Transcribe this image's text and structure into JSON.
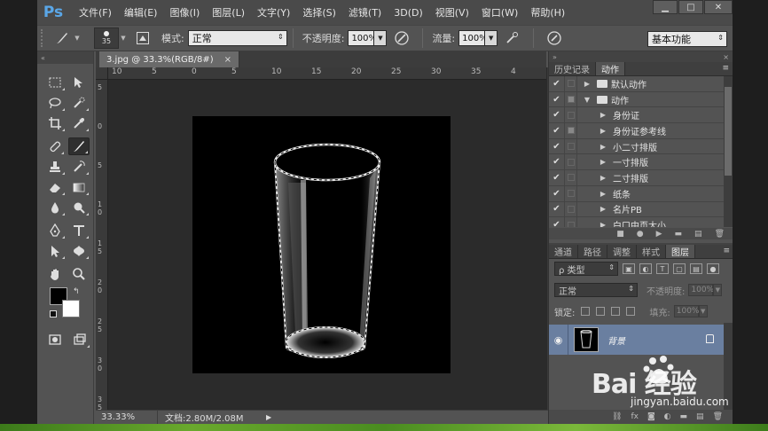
{
  "app": {
    "logo": "Ps",
    "menu": [
      "文件(F)",
      "编辑(E)",
      "图像(I)",
      "图层(L)",
      "文字(Y)",
      "选择(S)",
      "滤镜(T)",
      "3D(D)",
      "视图(V)",
      "窗口(W)",
      "帮助(H)"
    ],
    "window_controls": {
      "minimize": "▁",
      "maximize": "□",
      "close": "✕"
    }
  },
  "options": {
    "brush_size": "35",
    "mode_label": "模式:",
    "mode_value": "正常",
    "opacity_label": "不透明度:",
    "opacity_value": "100%",
    "flow_label": "流量:",
    "flow_value": "100%",
    "workspace": "基本功能"
  },
  "document": {
    "tab_title": "3.jpg @ 33.3%(RGB/8#)",
    "tab_close": "×",
    "ruler_top": [
      "10",
      "5",
      "0",
      "5",
      "10",
      "15",
      "20",
      "25",
      "30",
      "35",
      "4"
    ],
    "ruler_left": [
      "5",
      "0",
      "5",
      "10",
      "15",
      "20",
      "25",
      "30",
      "35"
    ],
    "zoom": "33.33%",
    "doc_info": "文档:2.80M/2.08M",
    "status_arrow": "▶"
  },
  "panels": {
    "top_tabs": [
      "历史记录",
      "动作"
    ],
    "top_tab_active": 1,
    "actions": [
      {
        "label": "默认动作",
        "type": "folder",
        "level": 0,
        "expanded": false,
        "box": false
      },
      {
        "label": "动作",
        "type": "folder",
        "level": 0,
        "expanded": true,
        "box": true
      },
      {
        "label": "身份证",
        "type": "action",
        "level": 1,
        "box": false
      },
      {
        "label": "身份证参考线",
        "type": "action",
        "level": 1,
        "box": true
      },
      {
        "label": "小二寸排版",
        "type": "action",
        "level": 1,
        "box": false
      },
      {
        "label": "一寸排版",
        "type": "action",
        "level": 1,
        "box": false
      },
      {
        "label": "二寸排版",
        "type": "action",
        "level": 1,
        "box": false
      },
      {
        "label": "纸条",
        "type": "action",
        "level": 1,
        "box": false
      },
      {
        "label": "名片PB",
        "type": "action",
        "level": 1,
        "box": false
      },
      {
        "label": "白口中页大小",
        "type": "action",
        "level": 1,
        "box": false
      }
    ],
    "layer_tabs": [
      "通道",
      "路径",
      "调整",
      "样式",
      "图层"
    ],
    "layer_tab_active": 4,
    "kind_filter": "ρ 类型",
    "blend_mode": "正常",
    "layer_opacity_label": "不透明度:",
    "layer_opacity_value": "100%",
    "lock_label": "锁定:",
    "fill_label": "填充:",
    "fill_value": "100%",
    "layers": [
      {
        "name": "背景",
        "visible": true,
        "locked": true
      }
    ]
  },
  "watermark": {
    "brand": "Bai  经验",
    "url": "jingyan.baidu.com"
  }
}
